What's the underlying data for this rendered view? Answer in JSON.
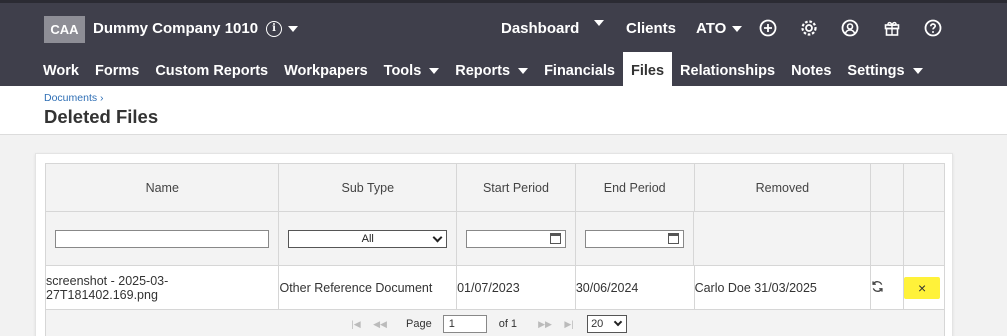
{
  "company": {
    "abbr": "CAA",
    "name": "Dummy Company 1010"
  },
  "top_nav": {
    "dashboard": "Dashboard",
    "clients": "Clients",
    "ato": "ATO"
  },
  "nav": [
    {
      "label": "Work"
    },
    {
      "label": "Forms"
    },
    {
      "label": "Custom Reports"
    },
    {
      "label": "Workpapers"
    },
    {
      "label": "Tools"
    },
    {
      "label": "Reports"
    },
    {
      "label": "Financials"
    },
    {
      "label": "Files"
    },
    {
      "label": "Relationships"
    },
    {
      "label": "Notes"
    },
    {
      "label": "Settings"
    }
  ],
  "breadcrumb": "Documents ›",
  "page_title": "Deleted Files",
  "table": {
    "columns": [
      "Name",
      "Sub Type",
      "Start Period",
      "End Period",
      "Removed"
    ],
    "filters": {
      "sub_type": "All"
    },
    "rows": [
      {
        "name": "screenshot - 2025-03-27T181402.169.png",
        "sub_type": "Other Reference Document",
        "start_period": "01/07/2023",
        "end_period": "30/06/2024",
        "removed": "Carlo Doe 31/03/2025",
        "delete_symbol": "×"
      }
    ]
  },
  "pager": {
    "page_label": "Page",
    "page_value": "1",
    "of_label": "of 1",
    "page_size": "20"
  },
  "colors": {
    "topbar": "#3f3f4b",
    "highlight": "#fff23a",
    "link": "#2f6fb5"
  },
  "icons": [
    "info-icon",
    "plus-circle-icon",
    "gear-icon",
    "user-circle-icon",
    "gift-icon",
    "help-circle-icon",
    "calendar-icon",
    "restore-icon",
    "close-icon"
  ]
}
